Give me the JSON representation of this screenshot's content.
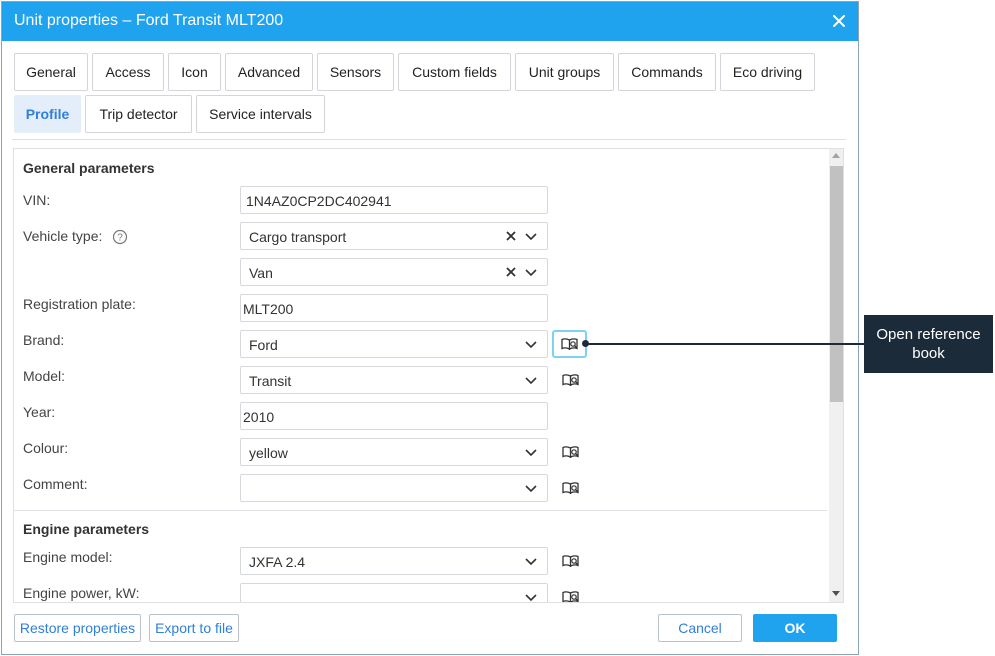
{
  "dialog": {
    "title": "Unit properties – Ford Transit MLT200"
  },
  "tabs": [
    {
      "label": "General"
    },
    {
      "label": "Access"
    },
    {
      "label": "Icon"
    },
    {
      "label": "Advanced"
    },
    {
      "label": "Sensors"
    },
    {
      "label": "Custom fields"
    },
    {
      "label": "Unit groups"
    },
    {
      "label": "Commands"
    },
    {
      "label": "Eco driving"
    },
    {
      "label": "Profile",
      "active": true
    },
    {
      "label": "Trip detector"
    },
    {
      "label": "Service intervals"
    }
  ],
  "general_parameters": {
    "title": "General parameters",
    "vin": {
      "label": "VIN:",
      "value": "1N4AZ0CP2DC402941"
    },
    "vehicle_type": {
      "label": "Vehicle type:",
      "value": "Cargo transport",
      "subtype": "Van"
    },
    "registration_plate": {
      "label": "Registration plate:",
      "value": "MLT200"
    },
    "brand": {
      "label": "Brand:",
      "value": "Ford"
    },
    "model": {
      "label": "Model:",
      "value": "Transit"
    },
    "year": {
      "label": "Year:",
      "value": "2010"
    },
    "colour": {
      "label": "Colour:",
      "value": "yellow"
    },
    "comment": {
      "label": "Comment:",
      "value": ""
    }
  },
  "engine_parameters": {
    "title": "Engine parameters",
    "engine_model": {
      "label": "Engine model:",
      "value": "JXFA 2.4"
    },
    "engine_power": {
      "label": "Engine power, kW:",
      "value": ""
    }
  },
  "footer": {
    "restore_label": "Restore properties",
    "export_label": "Export to file",
    "cancel_label": "Cancel",
    "ok_label": "OK"
  },
  "callout": {
    "text": "Open reference book"
  },
  "colors": {
    "accent": "#1fa3ef",
    "callout_bg": "#1c2b3a",
    "active_tab_bg": "#e4eefb",
    "link_blue": "#2f80d8",
    "highlight_border": "#7dd3ef"
  },
  "icons": {
    "close": "close-icon",
    "help": "question-circle-icon",
    "reference_book": "reference-book-icon",
    "dropdown": "chevron-down-icon",
    "clear": "clear-x-icon"
  }
}
